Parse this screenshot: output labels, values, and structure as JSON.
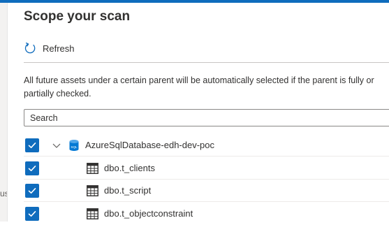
{
  "panel": {
    "title": "Scope your scan",
    "refresh_label": "Refresh",
    "info_text": "All future assets under a certain parent will be automatically selected if the parent is fully or partially checked.",
    "search_placeholder": "Search"
  },
  "left_partial_text": "us",
  "tree": {
    "root": {
      "label": "AzureSqlDatabase-edh-dev-poc",
      "checked": true,
      "expanded": true,
      "icon": "sql-database-icon"
    },
    "children": [
      {
        "label": "dbo.t_clients",
        "checked": true,
        "icon": "table-icon"
      },
      {
        "label": "dbo.t_script",
        "checked": true,
        "icon": "table-icon"
      },
      {
        "label": "dbo.t_objectconstraint",
        "checked": true,
        "icon": "table-icon"
      }
    ]
  },
  "colors": {
    "accent": "#0f6cbd",
    "text": "#323130",
    "border": "#8a8886"
  }
}
